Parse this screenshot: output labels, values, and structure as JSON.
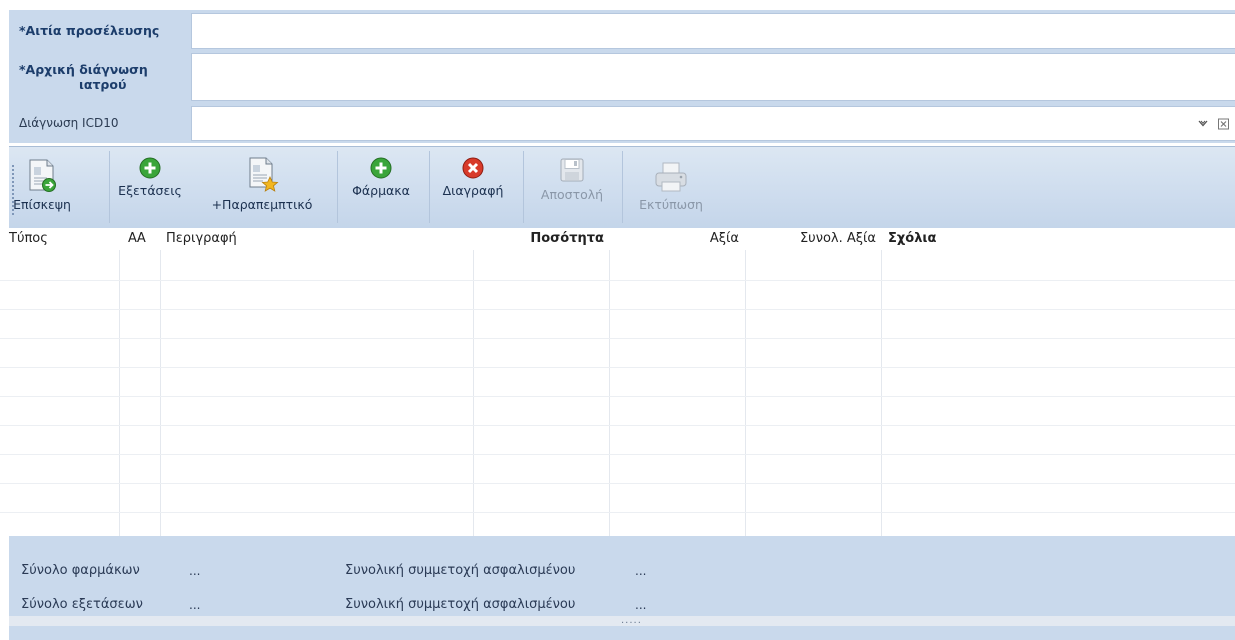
{
  "form": {
    "reason_label": "*Αιτία προσέλευσης",
    "reason_value": "",
    "diagnosis_label_line1": "*Αρχική διάγνωση",
    "diagnosis_label_line2": "ιατρού",
    "diagnosis_value": "",
    "icd_label": "Διάγνωση ICD10",
    "icd_value": ""
  },
  "toolbar": {
    "visit": "Επίσκεψη",
    "exams": "Εξετάσεις",
    "referral": "+Παραπεμπτικό",
    "drugs": "Φάρμακα",
    "delete": "Διαγραφή",
    "send": "Αποστολή",
    "print": "Εκτύπωση"
  },
  "table": {
    "columns": [
      "Τύπος",
      "ΑΑ",
      "Περιγραφή",
      "Ποσότητα",
      "Αξία",
      "Συνολ. Αξία",
      "Σχόλια"
    ],
    "rows": []
  },
  "footer": {
    "drugs_total_label": "Σύνολο φαρμάκων",
    "drugs_total_value": "...",
    "drugs_copay_label": "Συνολική συμμετοχή ασφαλισμένου",
    "drugs_copay_value": "...",
    "exams_total_label": "Σύνολο εξετάσεων",
    "exams_total_value": "...",
    "exams_copay_label": "Συνολική συμμετοχή ασφαλισμένου",
    "exams_copay_value": "...",
    "splitter_grip": "....."
  },
  "colors": {
    "panel": "#c9d9ec",
    "label_bold": "#1c3d6b",
    "add_green": "#3aa53a",
    "delete_red": "#d83a2a"
  },
  "icons": [
    "visit-document-icon",
    "add-exam-icon",
    "referral-document-icon",
    "add-drug-icon",
    "delete-icon",
    "save-disk-icon",
    "printer-icon",
    "dropdown-chevron-icon",
    "clear-icon"
  ]
}
